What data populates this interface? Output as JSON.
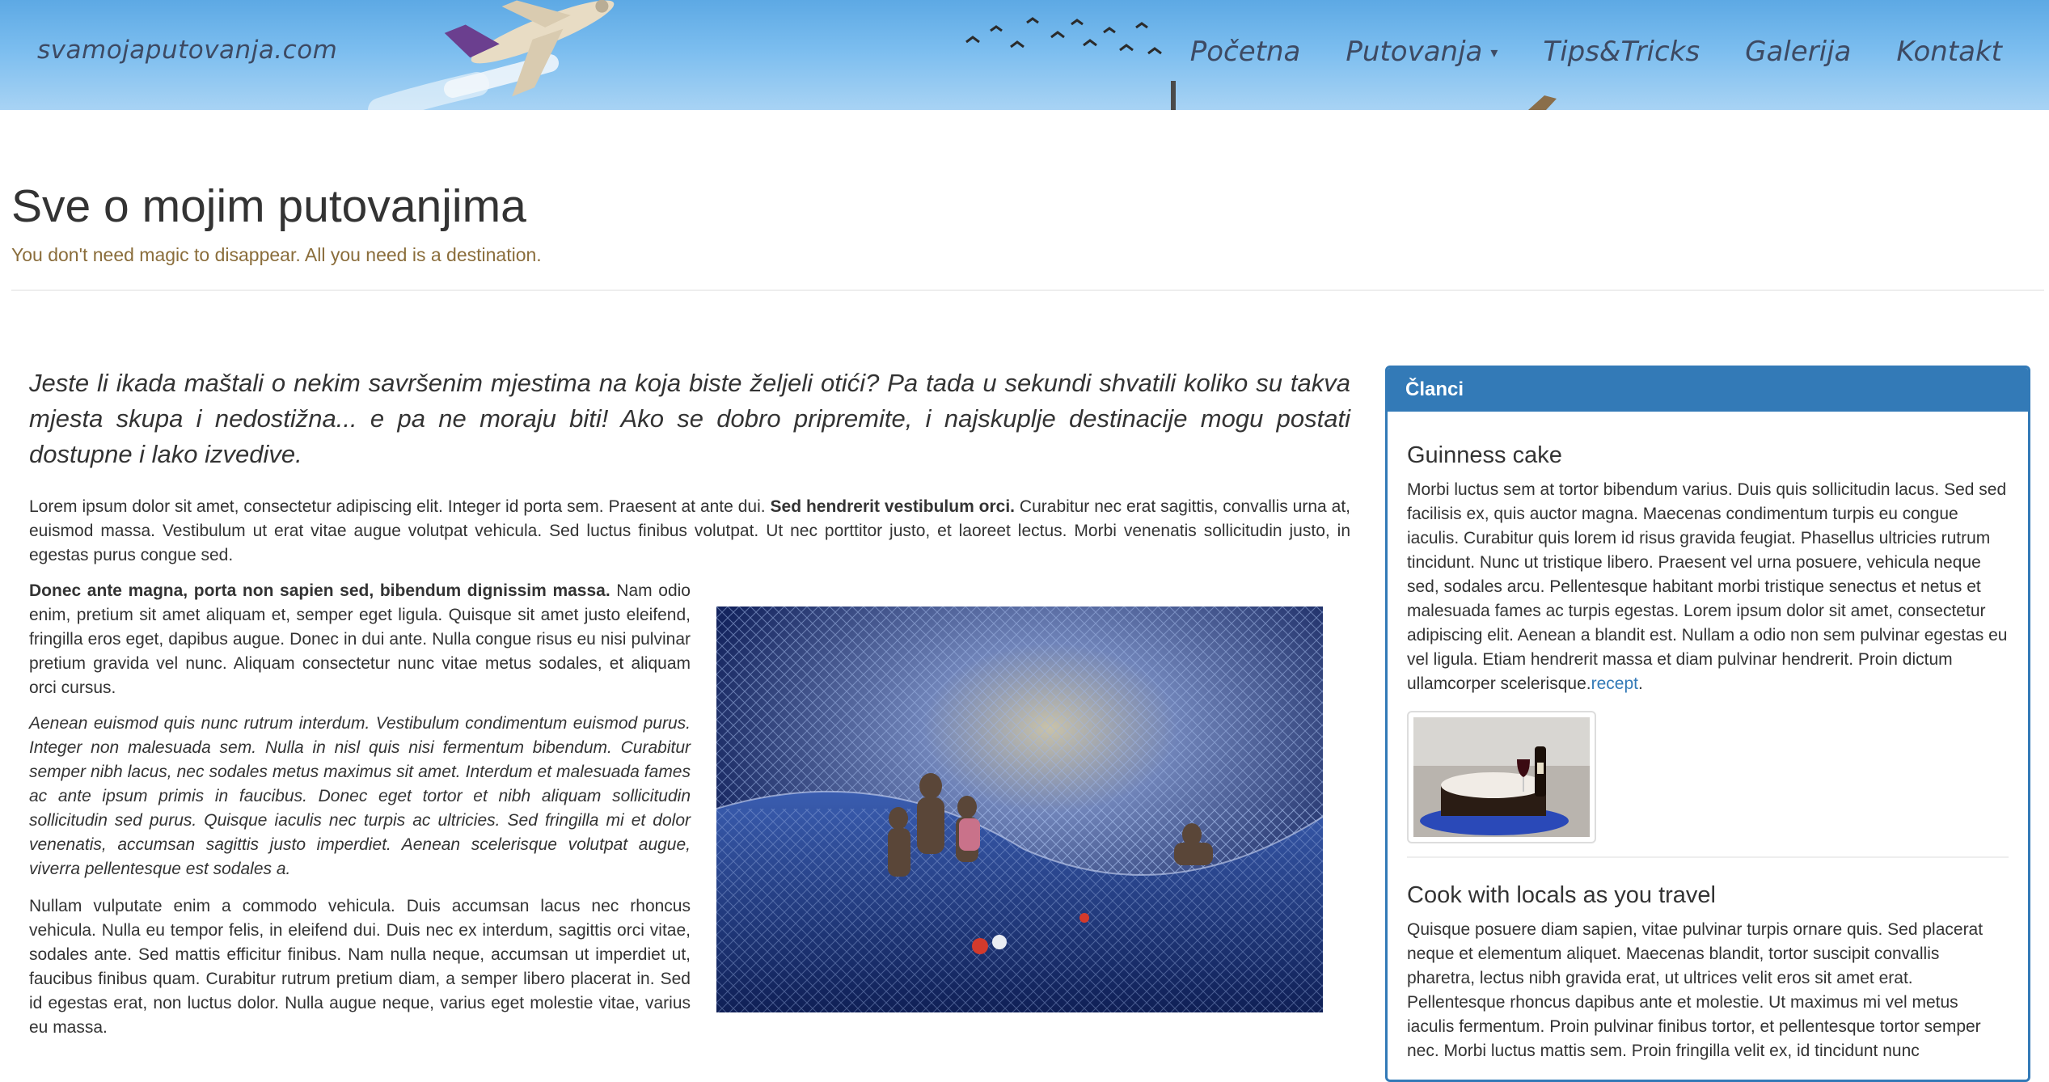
{
  "header": {
    "brand": "svamojaputovanja.com",
    "nav": [
      {
        "label": "Početna"
      },
      {
        "label": "Putovanja"
      },
      {
        "label": "Tips&Tricks"
      },
      {
        "label": "Galerija"
      },
      {
        "label": "Kontakt"
      }
    ]
  },
  "page": {
    "title": "Sve o mojim putovanjima",
    "tagline": "You don't need magic to disappear. All you need is a destination."
  },
  "main": {
    "lead": "Jeste li ikada maštali o nekim savršenim mjestima na koja biste željeli otići? Pa tada u sekundi shvatili koliko su takva mjesta skupa i nedostižna... e pa ne moraju biti! Ako se dobro pripremite, i najskuplje destinacije mogu postati dostupne i lako izvedive.",
    "p1_a": "Lorem ipsum dolor sit amet, consectetur adipiscing elit. Integer id porta sem. Praesent at ante dui. ",
    "p1_bold": "Sed hendrerit vestibulum orci.",
    "p1_b": " Curabitur nec erat sagittis, convallis urna at, euismod massa. Vestibulum ut erat vitae augue volutpat vehicula. Sed luctus finibus volutpat. Ut nec porttitor justo, et laoreet lectus. Morbi venenatis sollicitudin justo, in egestas purus congue sed.",
    "p2_bold": "Donec ante magna, porta non sapien sed, bibendum dignissim massa.",
    "p2": " Nam odio enim, pretium sit amet aliquam et, semper eget ligula. Quisque sit amet justo eleifend, fringilla eros eget, dapibus augue. Donec in dui ante. Nulla congue risus eu nisi pulvinar pretium gravida vel nunc. Aliquam consectetur nunc vitae metus sodales, et aliquam orci cursus.",
    "p3": "Aenean euismod quis nunc rutrum interdum. Vestibulum condimentum euismod purus. Integer non malesuada sem. Nulla in nisl quis nisi fermentum bibendum. Curabitur semper nibh lacus, nec sodales metus maximus sit amet. Interdum et malesuada fames ac ante ipsum primis in faucibus. Donec eget tortor et nibh aliquam sollicitudin sollicitudin sed purus. Quisque iaculis nec turpis ac ultricies. Sed fringilla mi et dolor venenatis, accumsan sagittis justo imperdiet. Aenean scelerisque volutpat augue, viverra pellentesque est sodales a.",
    "p4": "Nullam vulputate enim a commodo vehicula. Duis accumsan lacus nec rhoncus vehicula. Nulla eu tempor felis, in eleifend dui. Duis nec ex interdum, sagittis orci vitae, sodales ante. Sed mattis efficitur finibus. Nam nulla neque, accumsan ut imperdiet ut, faucibus finibus quam. Curabitur rutrum pretium diam, a semper libero placerat in. Sed id egestas erat, non luctus dolor. Nulla augue neque, varius eget molestie vitae, varius eu massa."
  },
  "sidebar": {
    "heading": "Članci",
    "articles": [
      {
        "title": "Guinness cake",
        "text": "Morbi luctus sem at tortor bibendum varius. Duis quis sollicitudin lacus. Sed sed facilisis ex, quis auctor magna. Maecenas condimentum turpis eu congue iaculis. Curabitur quis lorem id risus gravida feugiat. Phasellus ultricies rutrum tincidunt. Nunc ut tristique libero. Praesent vel urna posuere, vehicula neque sed, sodales arcu. Pellentesque habitant morbi tristique senectus et netus et malesuada fames ac turpis egestas. Lorem ipsum dolor sit amet, consectetur adipiscing elit. Aenean a blandit est. Nullam a odio non sem pulvinar egestas eu vel ligula. Etiam hendrerit massa et diam pulvinar hendrerit. Proin dictum ullamcorper scelerisque.",
        "link": "recept"
      },
      {
        "title": "Cook with locals as you travel",
        "text": "Quisque posuere diam sapien, vitae pulvinar turpis ornare quis. Sed placerat neque et elementum aliquet. Maecenas blandit, tortor suscipit convallis pharetra, lectus nibh gravida erat, ut ultrices velit eros sit amet erat. Pellentesque rhoncus dapibus ante et molestie. Ut maximus mi vel metus iaculis fermentum. Proin pulvinar finibus tortor, et pellentesque tortor semper nec. Morbi luctus mattis sem. Proin fringilla velit ex, id tincidunt nunc"
      }
    ]
  },
  "colors": {
    "primary": "#337ab7",
    "tagline": "#8a6d3b",
    "nav_text": "#3d4a63"
  }
}
